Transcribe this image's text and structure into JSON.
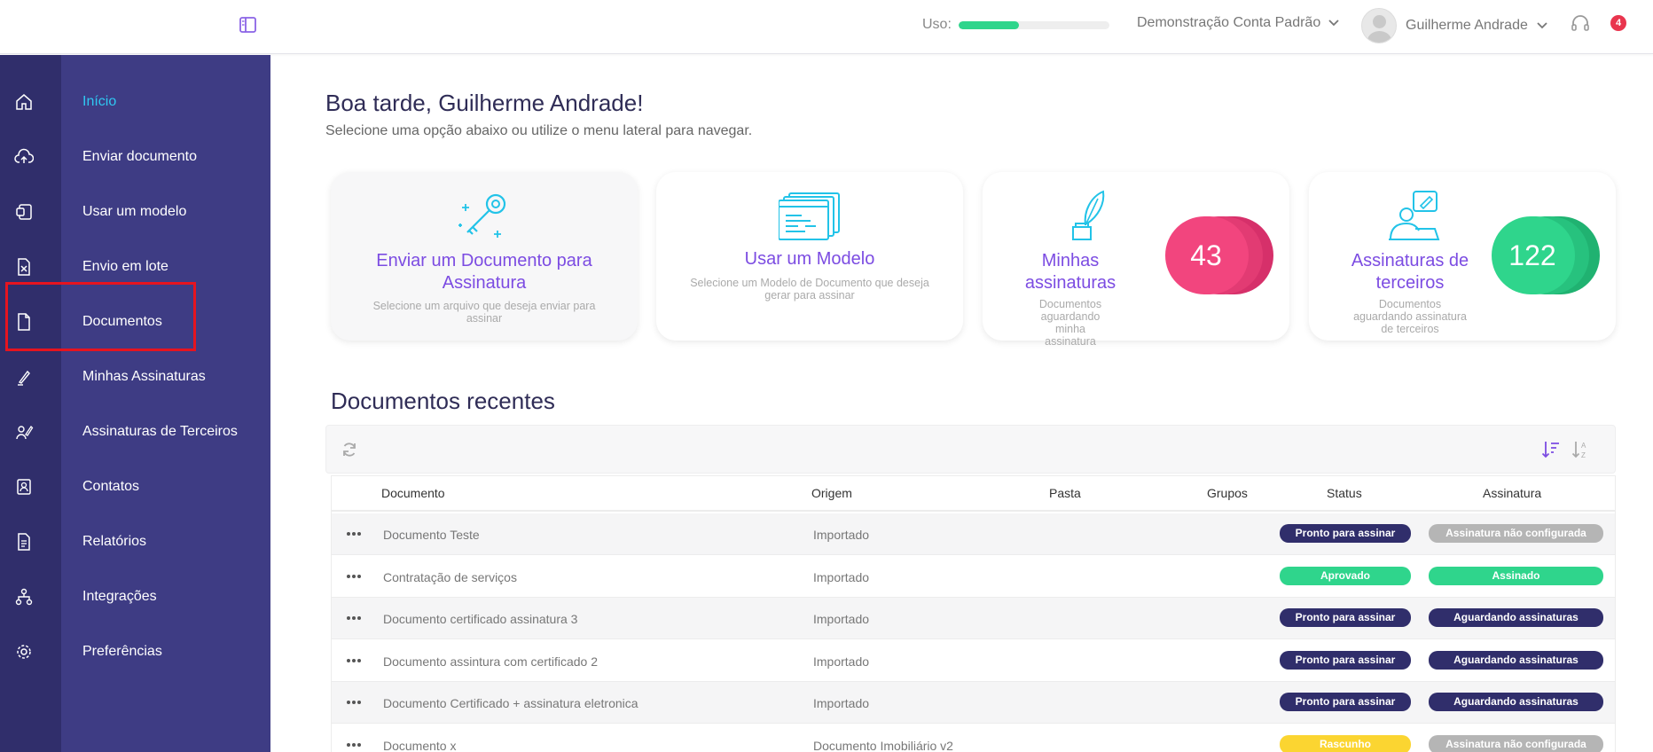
{
  "topbar": {
    "usage_label": "Uso:",
    "usage_fraction": 0.4,
    "account_name": "Demonstração Conta Padrão",
    "user_name": "Guilherme Andrade",
    "notification_count": "4"
  },
  "sidebar": {
    "items": [
      {
        "label": "Início",
        "icon": "home-icon",
        "active": true
      },
      {
        "label": "Enviar documento",
        "icon": "cloud-upload-icon"
      },
      {
        "label": "Usar um modelo",
        "icon": "template-icon"
      },
      {
        "label": "Envio em lote",
        "icon": "batch-file-icon"
      },
      {
        "label": "Documentos",
        "icon": "document-icon"
      },
      {
        "label": "Minhas Assinaturas",
        "icon": "pen-nib-icon"
      },
      {
        "label": "Assinaturas de Terceiros",
        "icon": "third-party-sign-icon"
      },
      {
        "label": "Contatos",
        "icon": "contact-book-icon"
      },
      {
        "label": "Relatórios",
        "icon": "report-icon"
      },
      {
        "label": "Integrações",
        "icon": "integrations-icon"
      },
      {
        "label": "Preferências",
        "icon": "gear-icon"
      }
    ]
  },
  "main": {
    "greeting": "Boa tarde, Guilherme Andrade!",
    "subgreeting": "Selecione uma opção abaixo ou utilize o menu lateral para navegar.",
    "cards": [
      {
        "title": "Enviar um Documento para Assinatura",
        "desc": "Selecione um arquivo que deseja enviar para assinar"
      },
      {
        "title": "Usar um Modelo",
        "desc": "Selecione um Modelo de Documento que deseja gerar para assinar"
      },
      {
        "title": "Minhas assinaturas",
        "desc": "Documentos aguardando minha assinatura",
        "count": "43"
      },
      {
        "title": "Assinaturas de terceiros",
        "desc": "Documentos aguardando assinatura de terceiros",
        "count": "122"
      }
    ],
    "recent_title": "Documentos recentes"
  },
  "table": {
    "headers": {
      "documento": "Documento",
      "origem": "Origem",
      "pasta": "Pasta",
      "grupos": "Grupos",
      "status": "Status",
      "assinatura": "Assinatura"
    },
    "rows": [
      {
        "documento": "Documento Teste",
        "origem": "Importado",
        "status": "Pronto para assinar",
        "assinatura": "Assinatura não configurada"
      },
      {
        "documento": "Contratação de serviços",
        "origem": "Importado",
        "status": "Aprovado",
        "assinatura": "Assinado"
      },
      {
        "documento": "Documento certificado assinatura 3",
        "origem": "Importado",
        "status": "Pronto para assinar",
        "assinatura": "Aguardando assinaturas"
      },
      {
        "documento": "Documento assintura com certificado 2",
        "origem": "Importado",
        "status": "Pronto para assinar",
        "assinatura": "Aguardando assinaturas"
      },
      {
        "documento": "Documento Certificado + assinatura eletronica",
        "origem": "Importado",
        "status": "Pronto para assinar",
        "assinatura": "Aguardando assinaturas"
      },
      {
        "documento": "Documento x",
        "origem": "Documento Imobiliário v2",
        "status": "Rascunho",
        "assinatura": "Assinatura não configurada"
      }
    ]
  },
  "colors": {
    "sidebar": "#3e3c84",
    "rail": "#302e6b",
    "active_nav": "#2fc8f2",
    "card_title": "#7c4ce2",
    "badge_navy": "#302e6b",
    "badge_green": "#2fd58c",
    "badge_gray": "#b5b5b5",
    "badge_yellow": "#fbd531",
    "counter_pink": "#f2457e",
    "counter_green": "#2fd58c"
  }
}
